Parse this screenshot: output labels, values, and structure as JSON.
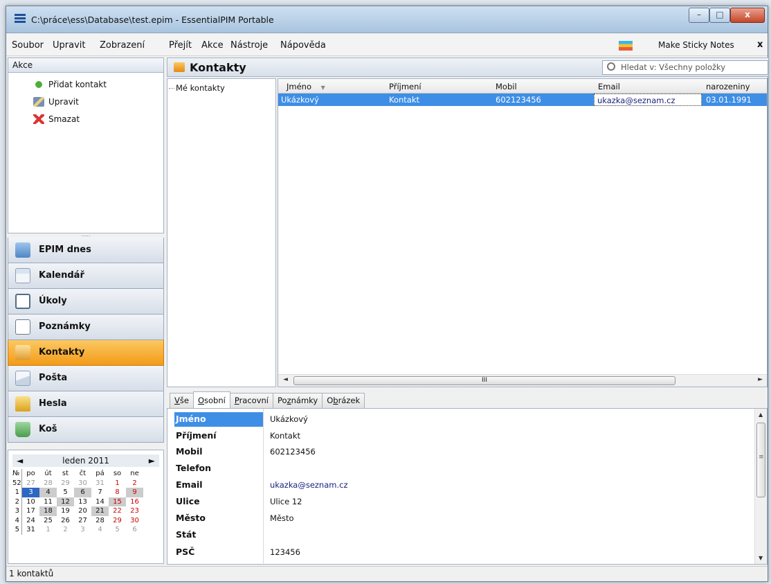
{
  "window": {
    "title": "C:\\práce\\ess\\Database\\test.epim - EssentialPIM Portable",
    "min": "–",
    "max": "□",
    "close": "x"
  },
  "menu": {
    "items": [
      "Soubor",
      "Upravit",
      "Zobrazení",
      "Přejít",
      "Akce",
      "Nástroje",
      "Nápověda"
    ],
    "sticky": "Make Sticky Notes",
    "close": "x"
  },
  "akce": {
    "title": "Akce",
    "items": [
      "Přidat kontakt",
      "Upravit",
      "Smazat"
    ]
  },
  "nav": [
    "EPIM dnes",
    "Kalendář",
    "Úkoly",
    "Poznámky",
    "Kontakty",
    "Pošta",
    "Hesla",
    "Koš"
  ],
  "calendar": {
    "month": "leden",
    "year": "2011",
    "prev": "◄",
    "next": "►",
    "header": [
      "№",
      "po",
      "út",
      "st",
      "čt",
      "pá",
      "so",
      "ne"
    ],
    "weeks": [
      [
        "52",
        "27",
        "28",
        "29",
        "30",
        "31",
        "1",
        "2"
      ],
      [
        "1",
        "3",
        "4",
        "5",
        "6",
        "7",
        "8",
        "9"
      ],
      [
        "2",
        "10",
        "11",
        "12",
        "13",
        "14",
        "15",
        "16"
      ],
      [
        "3",
        "17",
        "18",
        "19",
        "20",
        "21",
        "22",
        "23"
      ],
      [
        "4",
        "24",
        "25",
        "26",
        "27",
        "28",
        "29",
        "30"
      ],
      [
        "5",
        "31",
        "1",
        "2",
        "3",
        "4",
        "5",
        "6"
      ]
    ]
  },
  "main": {
    "title": "Kontakty",
    "search_placeholder": "Hledat v: Všechny položky",
    "tree_item": "Mé kontakty"
  },
  "grid": {
    "columns": [
      "Jméno",
      "Příjmení",
      "Mobil",
      "Email",
      "narozeniny"
    ],
    "sort_arrow": "▼",
    "row": {
      "jmeno": "Ukázkový",
      "prijmeni": "Kontakt",
      "mobil": "602123456",
      "email": "ukazka@seznam.cz",
      "narozeniny": "03.01.1991"
    },
    "scroll_left": "◄",
    "scroll_right": "►",
    "scroll_grip": "III"
  },
  "tabs": [
    {
      "first": "V",
      "rest": "še"
    },
    {
      "first": "O",
      "rest": "sobní"
    },
    {
      "first": "P",
      "rest": "racovní"
    },
    {
      "pre": "Po",
      "first": "z",
      "rest": "námky"
    },
    {
      "pre": "O",
      "first": "b",
      "rest": "rázek"
    }
  ],
  "details": [
    {
      "label": "Jméno",
      "value": "Ukázkový"
    },
    {
      "label": "Příjmení",
      "value": "Kontakt"
    },
    {
      "label": "Mobil",
      "value": "602123456"
    },
    {
      "label": "Telefon",
      "value": ""
    },
    {
      "label": "Email",
      "value": "ukazka@seznam.cz"
    },
    {
      "label": "Ulice",
      "value": "Ulice 12"
    },
    {
      "label": "Město",
      "value": "Město"
    },
    {
      "label": "Stát",
      "value": ""
    },
    {
      "label": "PSČ",
      "value": "123456"
    }
  ],
  "scroll": {
    "up": "▲",
    "down": "▼",
    "grip": "≡"
  },
  "status": "1 kontaktů",
  "colors": {
    "selection": "#3e8ee6",
    "active_nav": "#f39b18",
    "link": "#1a237e"
  }
}
